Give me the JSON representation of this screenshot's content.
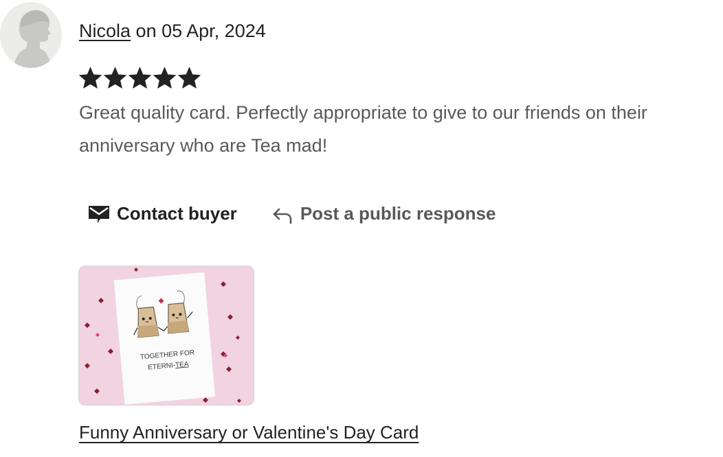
{
  "review": {
    "author": "Nicola",
    "date_prefix": "on",
    "date": "05 Apr, 2024",
    "rating": 5,
    "rating_max": 5,
    "text": "Great quality card. Perfectly appropriate to give to our friends on their anniversary who are Tea mad!"
  },
  "actions": {
    "contact_label": "Contact buyer",
    "contact_icon": "envelope-icon",
    "respond_label": "Post a public response",
    "respond_icon": "reply-arrow-icon"
  },
  "product": {
    "image_text_line1": "TOGETHER FOR",
    "image_text_line2_prefix": "ETERNI-",
    "image_text_line2_emph": "TEA",
    "title": "Funny Anniversary or Valentine's Day Card"
  },
  "colors": {
    "text_primary": "#222222",
    "text_secondary": "#595959",
    "star": "#222222",
    "thumb_bg": "#f1d3e2"
  }
}
